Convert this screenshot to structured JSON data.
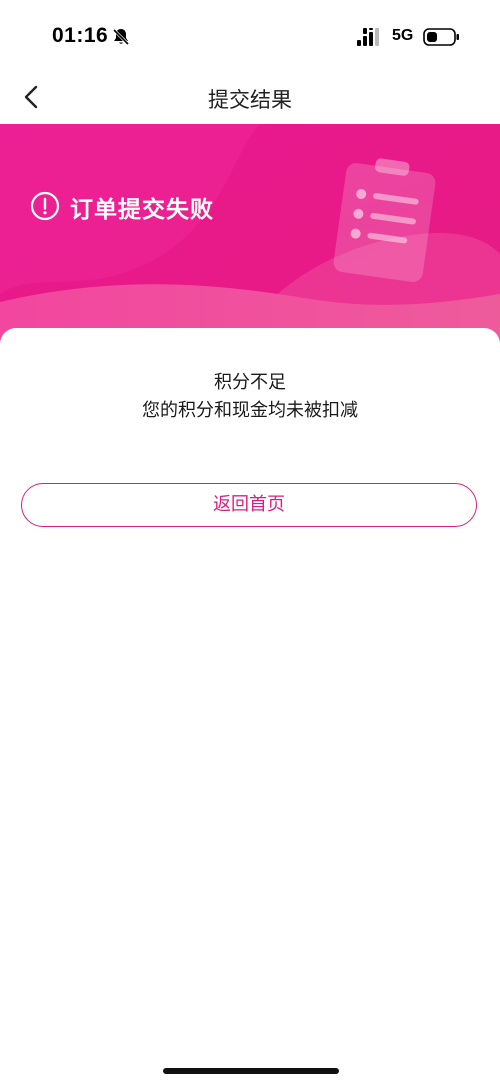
{
  "status_bar": {
    "time": "01:16",
    "network": "5G",
    "icons": [
      "bell-muted-icon",
      "signal-icon",
      "battery-icon"
    ]
  },
  "nav": {
    "title": "提交结果",
    "back_icon": "chevron-left-icon"
  },
  "banner": {
    "title": "订单提交失败",
    "icon": "exclamation-circle-icon",
    "illustration": "clipboard-icon",
    "gradient_start": "#ee1c93",
    "gradient_end": "#f0569e"
  },
  "result": {
    "line1": "积分不足",
    "line2": "您的积分和现金均未被扣减"
  },
  "actions": {
    "home_button": "返回首页"
  },
  "colors": {
    "accent": "#d81f7f",
    "background": "#ffffff"
  }
}
